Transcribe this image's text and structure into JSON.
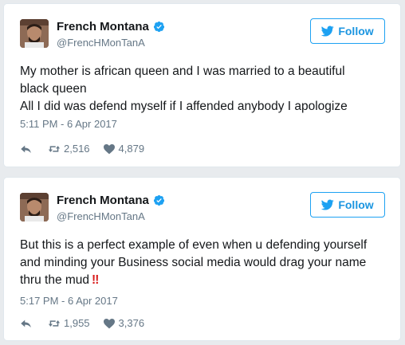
{
  "colors": {
    "accent": "#1da1f2",
    "verified": "#1da1f2",
    "muted": "#657786",
    "alert_red": "#d81b1b"
  },
  "tweets": [
    {
      "author": {
        "name": "French Montana",
        "handle": "@FrencHMonTanA",
        "verified": true
      },
      "follow_label": "Follow",
      "text_lines": [
        "My mother is african queen and I was married to a beautiful",
        "black queen",
        "All I did was defend myself if I affended anybody I apologize"
      ],
      "timestamp": "5:11 PM - 6 Apr 2017",
      "retweets": "2,516",
      "likes": "4,879"
    },
    {
      "author": {
        "name": "French Montana",
        "handle": "@FrencHMonTanA",
        "verified": true
      },
      "follow_label": "Follow",
      "text_lines": [
        "But this is a perfect example of even when u defending yourself",
        "and minding your Business social media would drag your name",
        "thru the mud"
      ],
      "emoji": "double-exclamation-icon",
      "emoji_text": "‼",
      "timestamp": "5:17 PM - 6 Apr 2017",
      "retweets": "1,955",
      "likes": "3,376"
    }
  ]
}
